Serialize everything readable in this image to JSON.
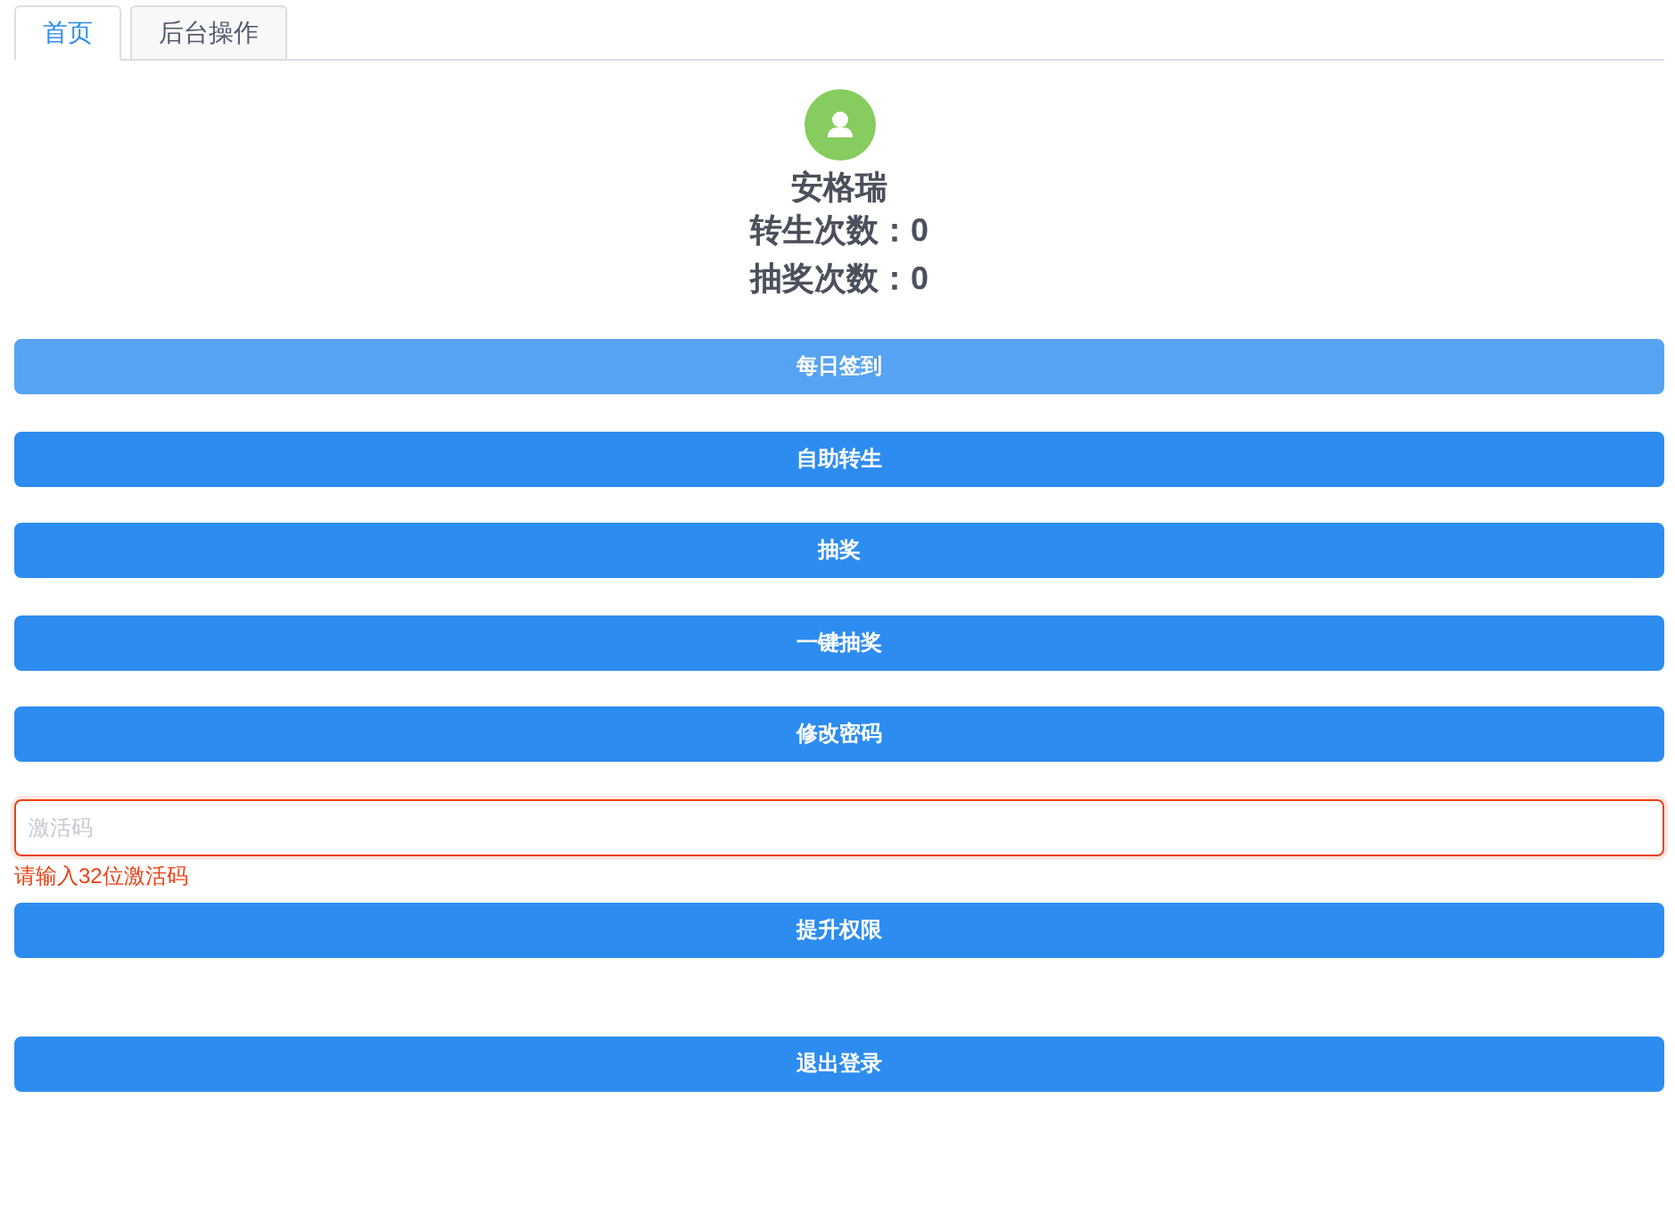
{
  "tabs": [
    {
      "label": "首页",
      "selected": true
    },
    {
      "label": "后台操作",
      "selected": false
    }
  ],
  "profile": {
    "name": "安格瑞",
    "stats": [
      "转生次数：0",
      "抽奖次数：0"
    ]
  },
  "actions": [
    {
      "label": "每日签到",
      "disabled": true
    },
    {
      "label": "自助转生",
      "disabled": false
    },
    {
      "label": "抽奖",
      "disabled": false
    },
    {
      "label": "一键抽奖",
      "disabled": false
    },
    {
      "label": "修改密码",
      "disabled": false
    }
  ],
  "activation": {
    "placeholder": "激活码",
    "invalid": true,
    "error": "请输入32位激活码",
    "button": {
      "label": "提升权限",
      "disabled": false
    }
  },
  "logout": {
    "label": "退出登录",
    "disabled": false
  }
}
